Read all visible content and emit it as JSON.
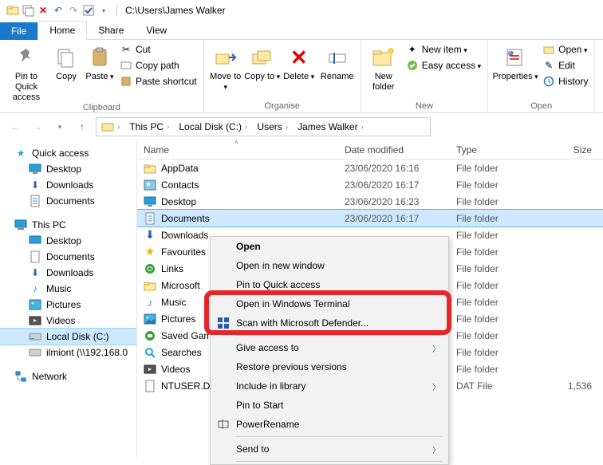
{
  "window": {
    "path": "C:\\Users\\James Walker"
  },
  "tabs": {
    "file": "File",
    "home": "Home",
    "share": "Share",
    "view": "View"
  },
  "ribbon": {
    "clipboard": {
      "label": "Clipboard",
      "pin": "Pin to Quick access",
      "copy": "Copy",
      "paste": "Paste",
      "cut": "Cut",
      "copy_path": "Copy path",
      "paste_shortcut": "Paste shortcut"
    },
    "organise": {
      "label": "Organise",
      "move_to": "Move to",
      "copy_to": "Copy to",
      "delete": "Delete",
      "rename": "Rename"
    },
    "new": {
      "label": "New",
      "new_folder": "New folder",
      "new_item": "New item",
      "easy_access": "Easy access"
    },
    "open": {
      "label": "Open",
      "properties": "Properties",
      "open": "Open",
      "edit": "Edit",
      "history": "History"
    }
  },
  "breadcrumb": [
    "This PC",
    "Local Disk (C:)",
    "Users",
    "James Walker"
  ],
  "tree": {
    "quick_access": "Quick access",
    "desktop": "Desktop",
    "downloads": "Downloads",
    "documents": "Documents",
    "this_pc": "This PC",
    "music": "Music",
    "pictures": "Pictures",
    "videos": "Videos",
    "local_disk": "Local Disk (C:)",
    "ilmiont": "ilmiont (\\\\192.168.0",
    "network": "Network"
  },
  "columns": {
    "name": "Name",
    "date": "Date modified",
    "type": "Type",
    "size": "Size"
  },
  "files": [
    {
      "icon": "folder",
      "name": "AppData",
      "date": "23/06/2020 16:16",
      "type": "File folder",
      "size": ""
    },
    {
      "icon": "contacts",
      "name": "Contacts",
      "date": "23/06/2020 16:17",
      "type": "File folder",
      "size": ""
    },
    {
      "icon": "desktop",
      "name": "Desktop",
      "date": "23/06/2020 16:23",
      "type": "File folder",
      "size": ""
    },
    {
      "icon": "documents",
      "name": "Documents",
      "date": "23/06/2020 16:17",
      "type": "File folder",
      "size": ""
    },
    {
      "icon": "downloads",
      "name": "Downloads",
      "date": "",
      "type": "File folder",
      "size": ""
    },
    {
      "icon": "favourites",
      "name": "Favourites",
      "date": "",
      "type": "File folder",
      "size": ""
    },
    {
      "icon": "links",
      "name": "Links",
      "date": "",
      "type": "File folder",
      "size": ""
    },
    {
      "icon": "folder",
      "name": "Microsoft",
      "date": "",
      "type": "File folder",
      "size": ""
    },
    {
      "icon": "music",
      "name": "Music",
      "date": "",
      "type": "File folder",
      "size": ""
    },
    {
      "icon": "pictures",
      "name": "Pictures",
      "date": "",
      "type": "File folder",
      "size": ""
    },
    {
      "icon": "saved",
      "name": "Saved Games",
      "date": "",
      "type": "File folder",
      "size": ""
    },
    {
      "icon": "searches",
      "name": "Searches",
      "date": "",
      "type": "File folder",
      "size": ""
    },
    {
      "icon": "videos",
      "name": "Videos",
      "date": "",
      "type": "File folder",
      "size": ""
    },
    {
      "icon": "datfile",
      "name": "NTUSER.DAT",
      "date": "",
      "type": "DAT File",
      "size": "1,536"
    }
  ],
  "context_menu": {
    "open": "Open",
    "open_new": "Open in new window",
    "pin_qa": "Pin to Quick access",
    "open_wt": "Open in Windows Terminal",
    "scan_defender": "Scan with Microsoft Defender...",
    "give_access": "Give access to",
    "restore": "Restore previous versions",
    "include_lib": "Include in library",
    "pin_start": "Pin to Start",
    "powerrename": "PowerRename",
    "send_to": "Send to"
  }
}
